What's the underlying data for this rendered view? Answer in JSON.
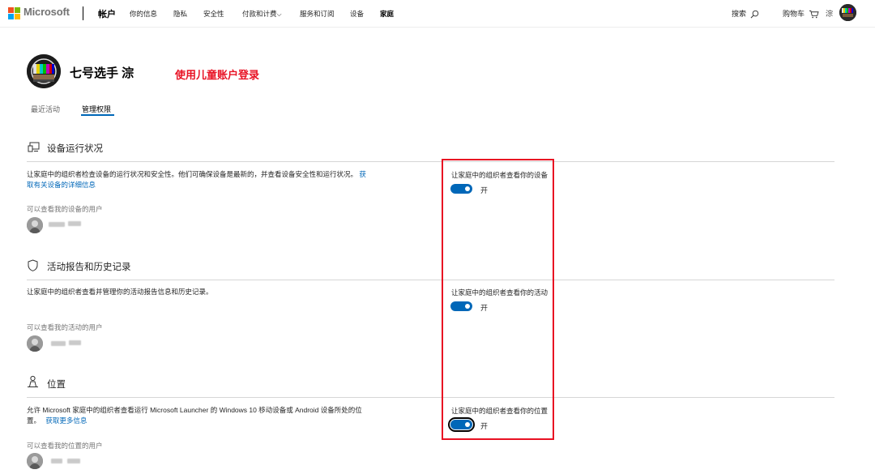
{
  "header": {
    "brand": "Microsoft",
    "account": "帐户",
    "nav": [
      {
        "label": "你的信息"
      },
      {
        "label": "隐私"
      },
      {
        "label": "安全性"
      },
      {
        "label": "付款和计费"
      },
      {
        "label": "服务和订阅"
      },
      {
        "label": "设备"
      },
      {
        "label": "家庭"
      }
    ],
    "search_label": "搜索",
    "cart_label": "购物车",
    "user_short": "淙"
  },
  "profile": {
    "name": "七号选手 淙",
    "note": "使用儿童账户登录"
  },
  "tabs": [
    {
      "label": "最近活动"
    },
    {
      "label": "管理权限"
    }
  ],
  "sections": [
    {
      "title": "设备运行状况",
      "desc_line1": "让家庭中的组织者检查设备的运行状况和安全性。他们可确保设备是最新的，并查看设备安全性和运行状况。",
      "link_part1": "获",
      "link_part2": "取有关设备的详细信息",
      "sublabel": "可以查看我的设备的用户",
      "toggle_label": "让家庭中的组织者查看你的设备",
      "toggle_state": "开"
    },
    {
      "title": "活动报告和历史记录",
      "desc_line1": "让家庭中的组织者查看并管理你的活动报告信息和历史记录。",
      "sublabel": "可以查看我的活动的用户",
      "toggle_label": "让家庭中的组织者查看你的活动",
      "toggle_state": "开"
    },
    {
      "title": "位置",
      "desc_line1": "允许 Microsoft 家庭中的组织者查看运行 Microsoft Launcher 的 Windows 10 移动设备或 Android 设备所处的位",
      "desc_line2": "置。",
      "link": "获取更多信息",
      "sublabel": "可以查看我的位置的用户",
      "toggle_label": "让家庭中的组织者查看你的位置",
      "toggle_state": "开"
    }
  ],
  "colors": {
    "accent": "#0067b8",
    "annotation": "#e81123"
  }
}
